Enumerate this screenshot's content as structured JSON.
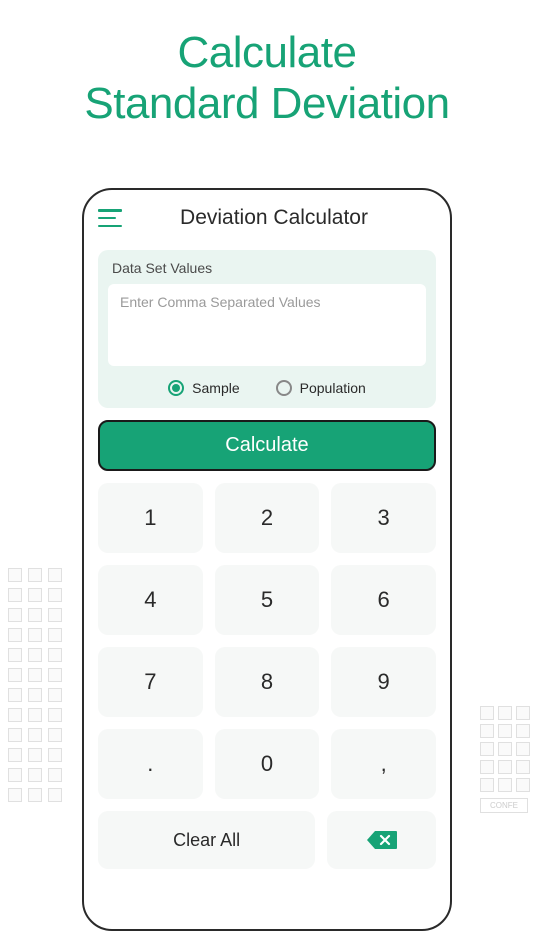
{
  "hero": {
    "line1": "Calculate",
    "line2": "Standard Deviation"
  },
  "app": {
    "title": "Deviation Calculator"
  },
  "input": {
    "label": "Data Set Values",
    "placeholder": "Enter Comma Separated Values"
  },
  "radios": {
    "sample": "Sample",
    "population": "Population",
    "selected": "sample"
  },
  "buttons": {
    "calculate": "Calculate",
    "clearAll": "Clear All"
  },
  "keypad": {
    "keys": [
      "1",
      "2",
      "3",
      "4",
      "5",
      "6",
      "7",
      "8",
      "9",
      ".",
      "0",
      ","
    ]
  },
  "colors": {
    "accent": "#17a376"
  }
}
